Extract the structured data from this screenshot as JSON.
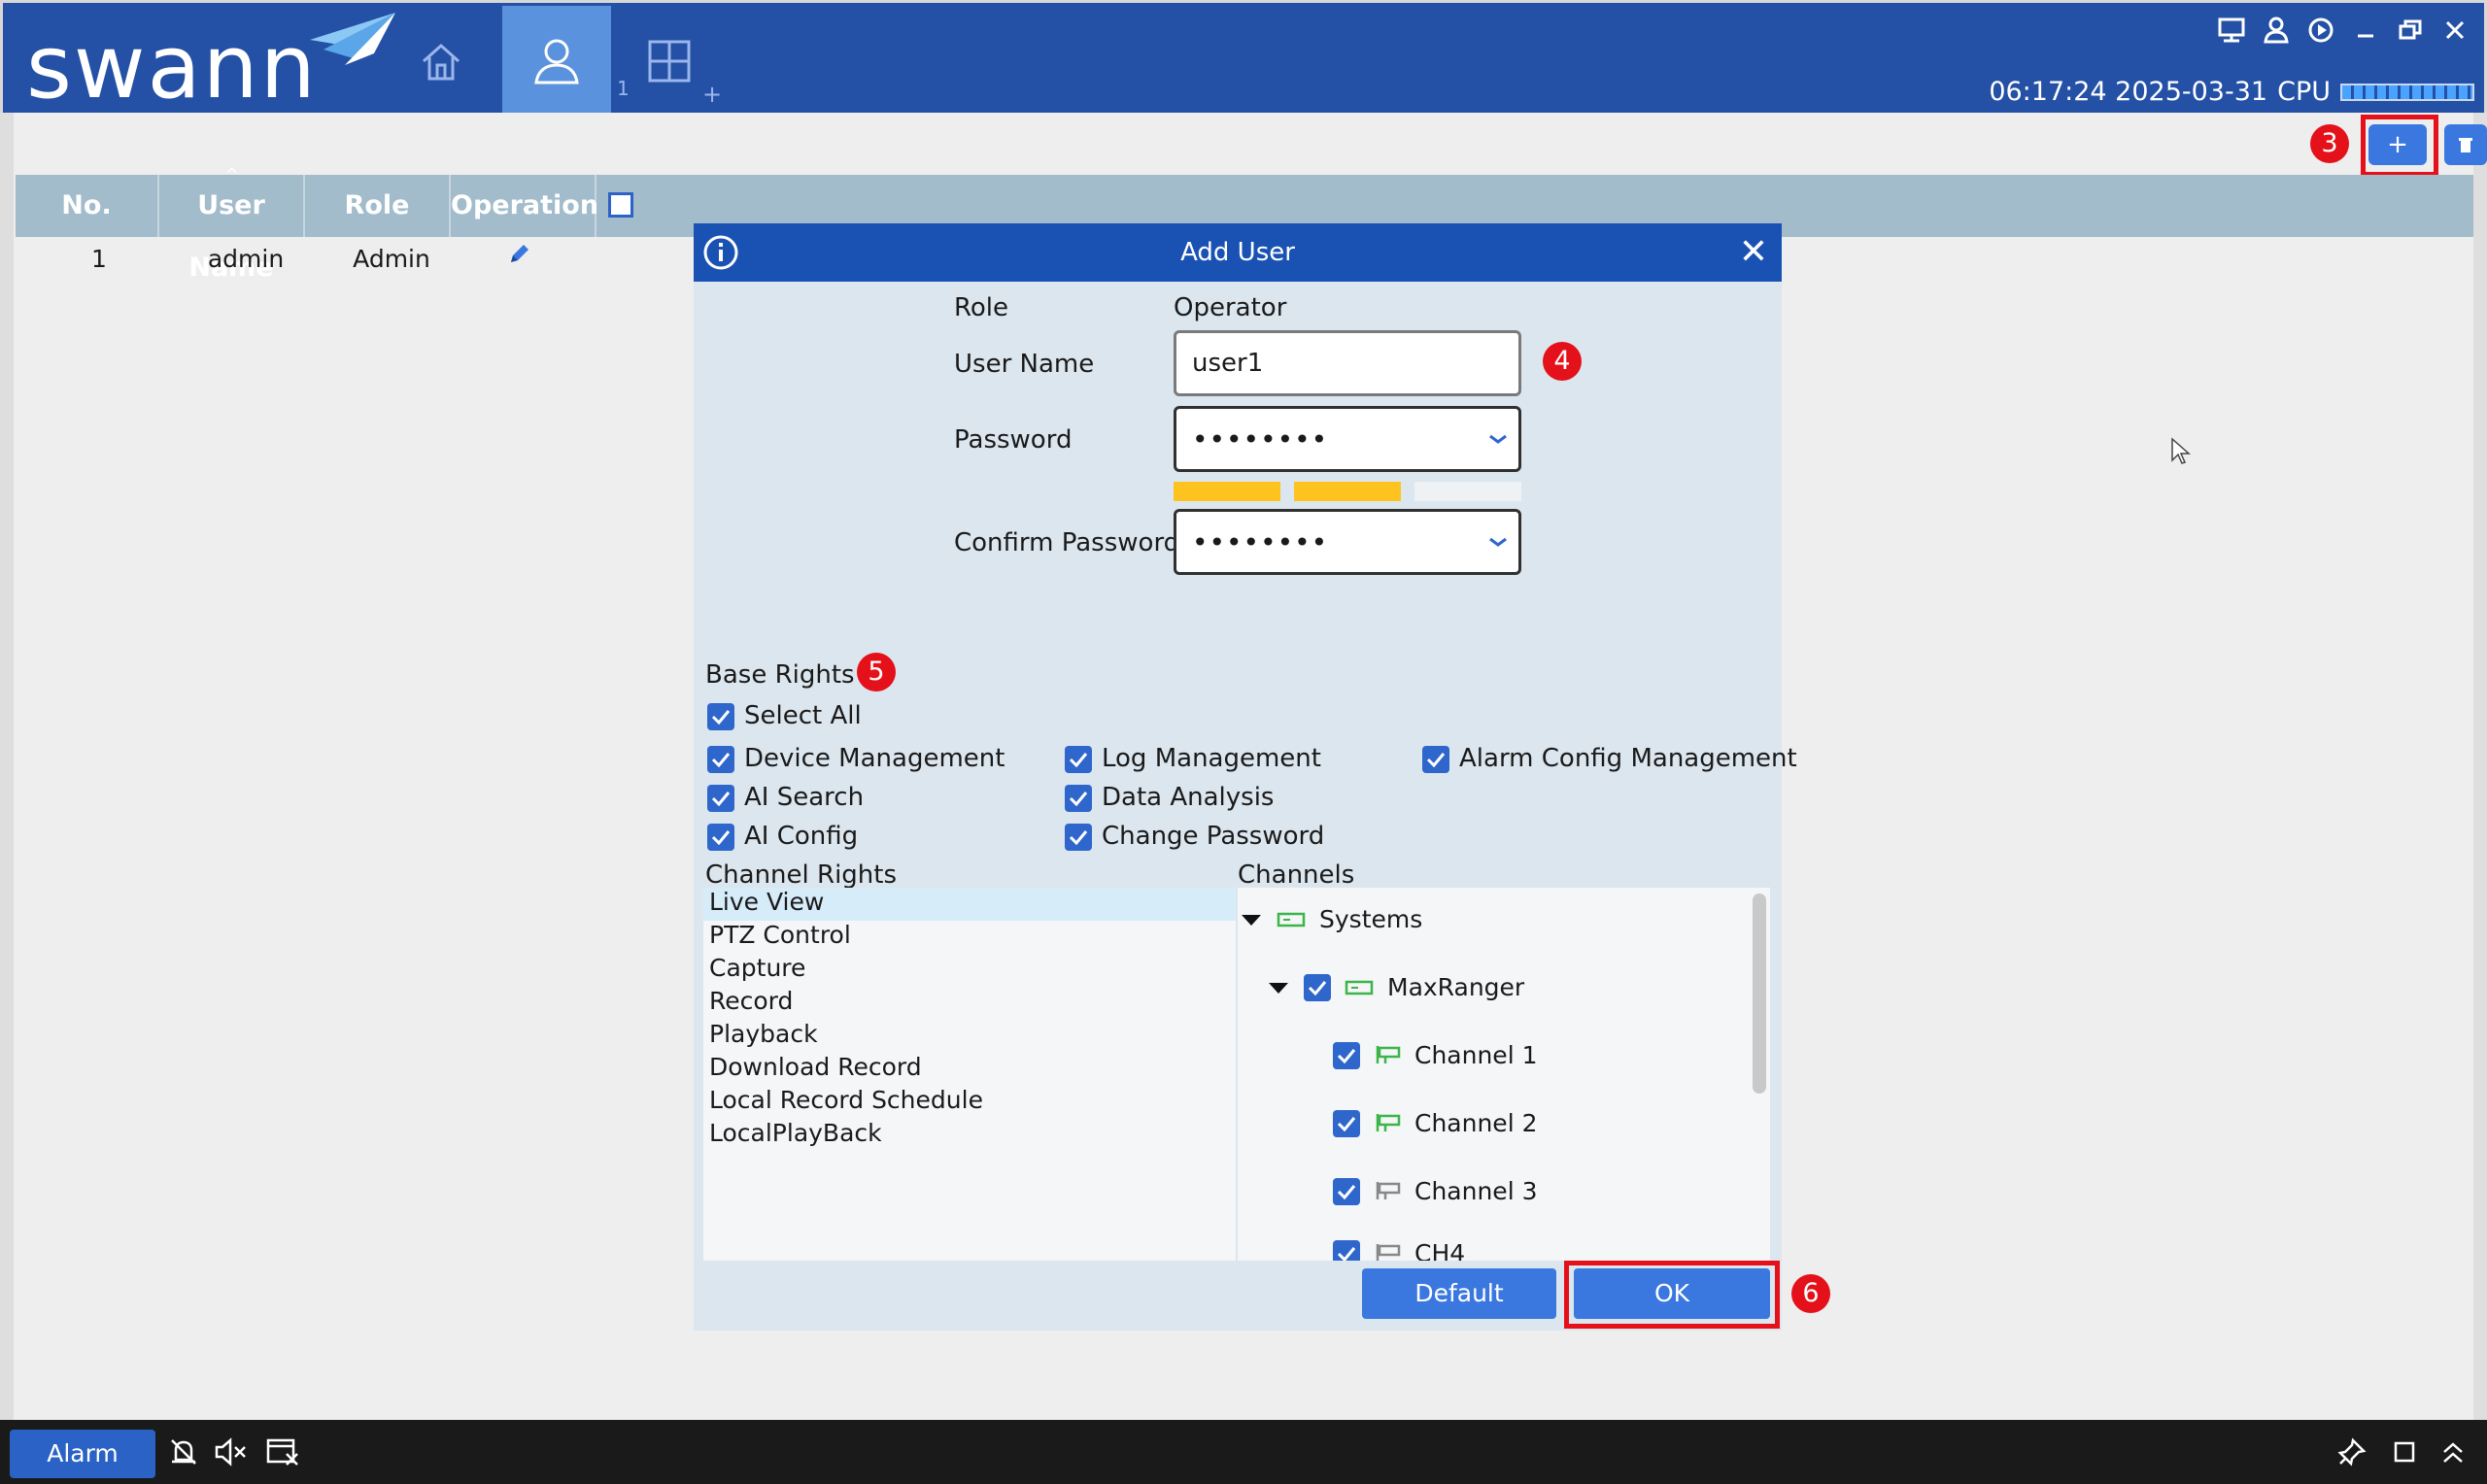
{
  "app": {
    "brand": "swann",
    "tab_grid_sub": "1",
    "tab_grid_plus": "+",
    "clock": "06:17:24 2025-03-31",
    "cpu_label": "CPU"
  },
  "user_table": {
    "columns": [
      "No.",
      "User Name",
      "Role",
      "Operation"
    ],
    "rows": [
      {
        "no": "1",
        "user_name": "admin",
        "role": "Admin"
      }
    ]
  },
  "toolbar": {
    "add_label": "+"
  },
  "annotations": {
    "step3": "3",
    "step4": "4",
    "step5": "5",
    "step6": "6"
  },
  "dialog": {
    "title": "Add User",
    "close": "✕",
    "role_label": "Role",
    "role_value": "Operator",
    "username_label": "User Name",
    "username_value": "user1",
    "password_label": "Password",
    "password_value": "••••••••",
    "confirm_label": "Confirm Password",
    "confirm_value": "••••••••",
    "password_strength_segments_filled": 2,
    "base_rights_label": "Base Rights",
    "select_all": "Select All",
    "rights": {
      "device_management": "Device Management",
      "log_management": "Log Management",
      "alarm_config_management": "Alarm Config Management",
      "ai_search": "AI Search",
      "data_analysis": "Data Analysis",
      "ai_config": "AI Config",
      "change_password": "Change Password"
    },
    "channel_rights_label": "Channel Rights",
    "channel_rights": [
      "Live View",
      "PTZ Control",
      "Capture",
      "Record",
      "Playback",
      "Download Record",
      "Local Record Schedule",
      "LocalPlayBack"
    ],
    "channels_label": "Channels",
    "channels": {
      "root": "Systems",
      "device": "MaxRanger",
      "ch1": "Channel 1",
      "ch2": "Channel 2",
      "ch3": "Channel 3",
      "ch4": "CH4"
    },
    "default_button": "Default",
    "ok_button": "OK"
  },
  "bottom": {
    "alarm_button": "Alarm"
  },
  "colors": {
    "topbar": "#2450a6",
    "dialog_header": "#1a52b4",
    "accent": "#3a78e0",
    "highlight": "#e4101a",
    "strength": "#ffc320"
  }
}
